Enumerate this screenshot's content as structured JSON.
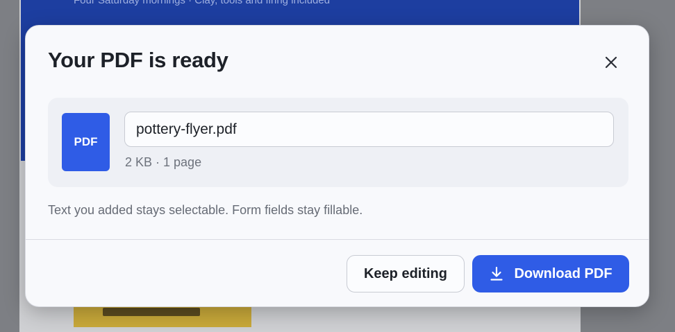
{
  "background": {
    "banner_text": "Four Saturday mornings · Clay, tools and firing included"
  },
  "dialog": {
    "title": "Your PDF is ready",
    "close_icon": "close-icon",
    "file": {
      "badge": "PDF",
      "filename": "pottery-flyer.pdf",
      "meta": "2  KB · 1 page"
    },
    "helper_text": "Text you added stays selectable. Form fields stay fillable.",
    "actions": {
      "keep_editing_label": "Keep editing",
      "download_label": "Download PDF",
      "download_icon": "download-icon"
    }
  },
  "colors": {
    "accent": "#2f5ce6",
    "dialog_bg": "#f8f9fc",
    "card_bg": "#eef0f5",
    "text_primary": "#1d2128",
    "text_muted": "#6d727c"
  }
}
